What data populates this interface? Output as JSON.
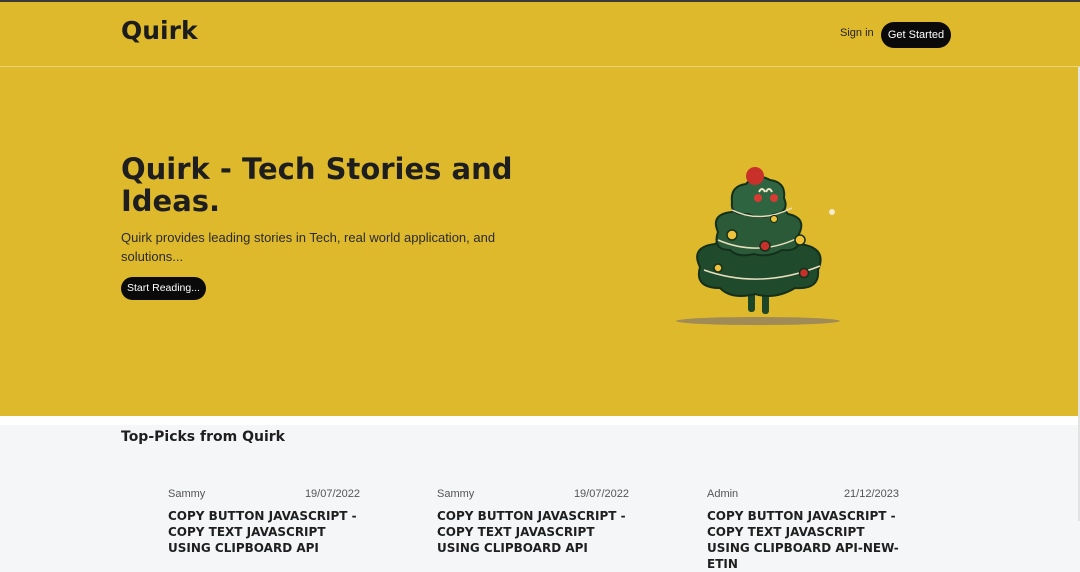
{
  "nav": {
    "logo": "Quirk",
    "sign_in": "Sign in",
    "get_started": "Get Started"
  },
  "hero": {
    "title": "Quirk - Tech Stories and Ideas.",
    "subtitle": "Quirk provides leading stories in Tech, real world application, and solutions...",
    "cta": "Start Reading...",
    "illustration": "christmas-tree-illustration"
  },
  "picks": {
    "heading": "Top-Picks from Quirk",
    "cards": [
      {
        "author": "Sammy",
        "date": "19/07/2022",
        "title": "COPY BUTTON JAVASCRIPT - COPY TEXT JAVASCRIPT USING CLIPBOARD API"
      },
      {
        "author": "Sammy",
        "date": "19/07/2022",
        "title": "COPY BUTTON JAVASCRIPT - COPY TEXT JAVASCRIPT USING CLIPBOARD API"
      },
      {
        "author": "Admin",
        "date": "21/12/2023",
        "title": "COPY BUTTON JAVASCRIPT - COPY TEXT JAVASCRIPT USING CLIPBOARD API-NEW-ETIN"
      }
    ]
  },
  "colors": {
    "brand": "#dfb92c",
    "button": "#0a0a0a",
    "page_bg": "#f5f6f8"
  }
}
